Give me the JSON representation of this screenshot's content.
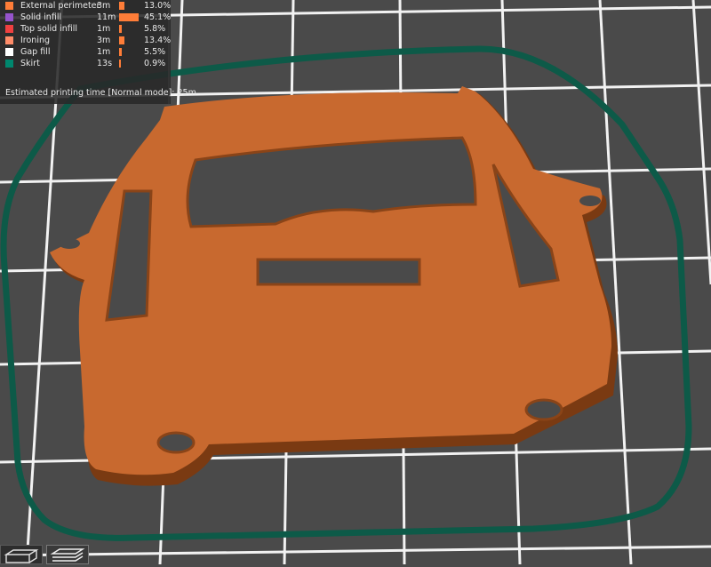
{
  "legend": {
    "rows": [
      {
        "name": "External perimeter",
        "time": "3m",
        "pct": "13.0%",
        "fraction": 0.13,
        "color": "#ff7d38"
      },
      {
        "name": "Solid infill",
        "time": "11m",
        "pct": "45.1%",
        "fraction": 0.451,
        "color": "#9654cc"
      },
      {
        "name": "Top solid infill",
        "time": "1m",
        "pct": "5.8%",
        "fraction": 0.058,
        "color": "#f04040"
      },
      {
        "name": "Ironing",
        "time": "3m",
        "pct": "13.4%",
        "fraction": 0.134,
        "color": "#ff8c69"
      },
      {
        "name": "Gap fill",
        "time": "1m",
        "pct": "5.5%",
        "fraction": 0.055,
        "color": "#ffffff"
      },
      {
        "name": "Skirt",
        "time": "13s",
        "pct": "0.9%",
        "fraction": 0.009,
        "color": "#00876e"
      }
    ],
    "bar_color": "#ff7d38",
    "estimated_label": "Estimated printing time [Normal mode]:",
    "estimated_value": "25m"
  },
  "view_buttons": [
    {
      "icon": "3d-view-cube-icon"
    },
    {
      "icon": "layers-view-icon"
    }
  ],
  "colors": {
    "bed": "#4a4a4a",
    "grid": "#ffffff",
    "model": "#c8692f",
    "model_edge": "#8a4418",
    "skirt": "#0d5a48"
  }
}
